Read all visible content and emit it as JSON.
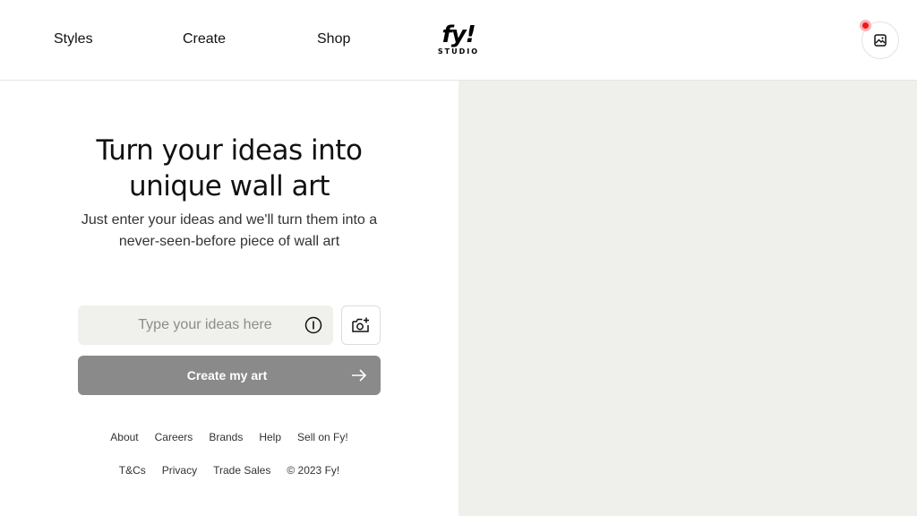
{
  "nav": {
    "styles": "Styles",
    "create": "Create",
    "shop": "Shop"
  },
  "logo": {
    "main": "fy!",
    "sub": "STUDIO"
  },
  "saved": {
    "icon": "image-icon",
    "notification": true
  },
  "hero": {
    "headline_line1": "Turn your ideas into",
    "headline_line2": "unique wall art",
    "subline_line1": "Just enter your ideas and we'll turn them into a",
    "subline_line2": "never-seen-before piece of wall art"
  },
  "prompt": {
    "value": "",
    "placeholder": "Type your ideas here",
    "info_icon": "info-icon",
    "camera_icon": "camera-add-icon"
  },
  "cta": {
    "label": "Create my art",
    "icon": "arrow-right-icon"
  },
  "footer": {
    "row1": [
      "About",
      "Careers",
      "Brands",
      "Help",
      "Sell on Fy!"
    ],
    "row2": [
      "T&Cs",
      "Privacy",
      "Trade Sales"
    ],
    "copyright": "© 2023 Fy!"
  },
  "colors": {
    "preview_bg": "#efefeb",
    "input_bg": "#f0f0ec",
    "cta_disabled": "#8a8a8a",
    "notification": "#f2161d"
  }
}
